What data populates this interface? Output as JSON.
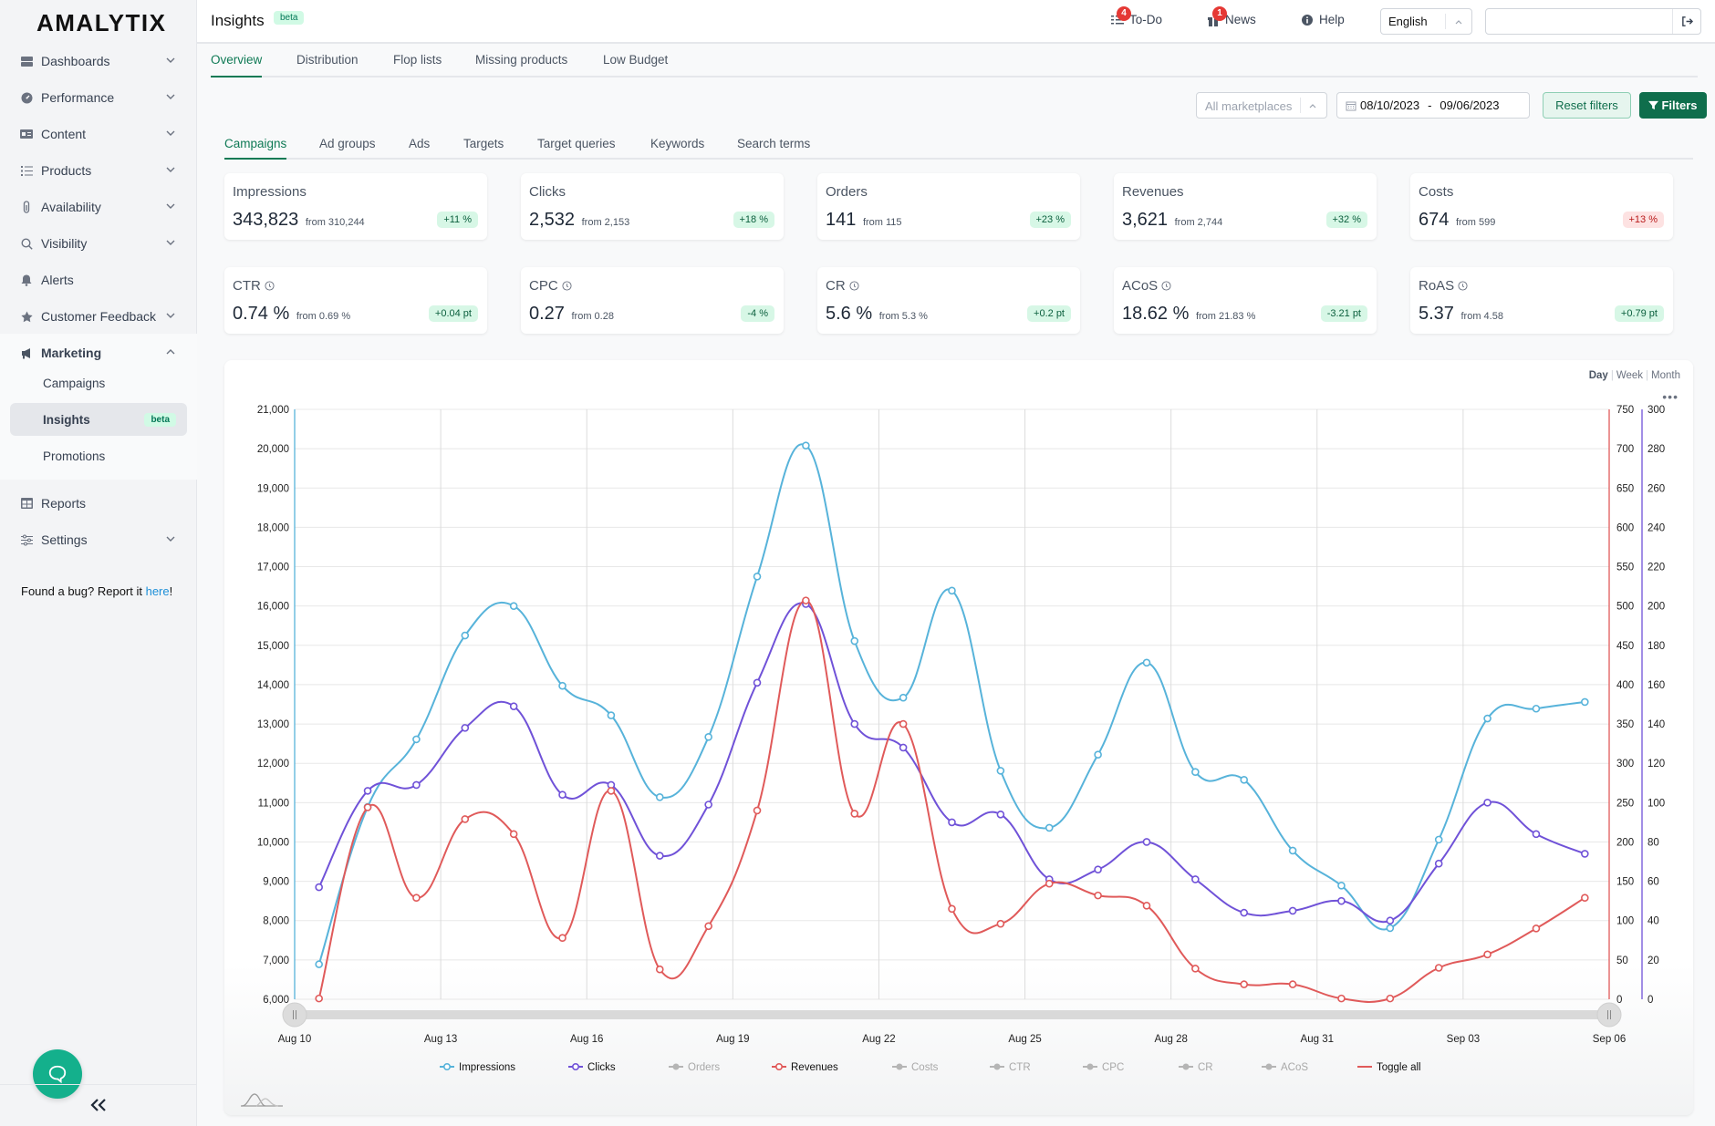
{
  "sidebar": {
    "logo": "AMALYTIX",
    "items": [
      {
        "label": "Dashboards",
        "icon": "server-icon",
        "chevron": "down"
      },
      {
        "label": "Performance",
        "icon": "gauge-icon",
        "chevron": "down"
      },
      {
        "label": "Content",
        "icon": "id-card-icon",
        "chevron": "down"
      },
      {
        "label": "Products",
        "icon": "list-icon",
        "chevron": "down"
      },
      {
        "label": "Availability",
        "icon": "thermometer-icon",
        "chevron": "down"
      },
      {
        "label": "Visibility",
        "icon": "search-icon",
        "chevron": "down"
      },
      {
        "label": "Alerts",
        "icon": "bell-icon",
        "chevron": ""
      },
      {
        "label": "Customer Feedback",
        "icon": "star-icon",
        "chevron": "down"
      },
      {
        "label": "Marketing",
        "icon": "megaphone-icon",
        "chevron": "up"
      },
      {
        "label": "Reports",
        "icon": "table-icon",
        "chevron": ""
      },
      {
        "label": "Settings",
        "icon": "sliders-icon",
        "chevron": "down"
      }
    ],
    "marketing_sub": [
      {
        "label": "Campaigns",
        "active": false
      },
      {
        "label": "Insights",
        "active": true,
        "badge": "beta"
      },
      {
        "label": "Promotions",
        "active": false
      }
    ],
    "bug_text": "Found a bug? Report it ",
    "bug_link": "here",
    "bug_suffix": "!"
  },
  "header": {
    "title": "Insights",
    "title_badge": "beta",
    "todo": {
      "label": "To-Do",
      "count": "4"
    },
    "news": {
      "label": "News",
      "count": "1"
    },
    "help": {
      "label": "Help"
    },
    "language": "English",
    "user_value": ""
  },
  "main_tabs": [
    {
      "label": "Overview",
      "active": true
    },
    {
      "label": "Distribution",
      "active": false
    },
    {
      "label": "Flop lists",
      "active": false
    },
    {
      "label": "Missing products",
      "active": false
    },
    {
      "label": "Low Budget",
      "active": false
    }
  ],
  "filters": {
    "marketplace_placeholder": "All marketplaces",
    "date_from": "08/10/2023",
    "date_sep": "-",
    "date_to": "09/06/2023",
    "reset_label": "Reset filters",
    "filters_label": "Filters"
  },
  "sub_tabs": [
    {
      "label": "Campaigns",
      "active": true
    },
    {
      "label": "Ad groups",
      "active": false
    },
    {
      "label": "Ads",
      "active": false
    },
    {
      "label": "Targets",
      "active": false
    },
    {
      "label": "Target queries",
      "active": false
    },
    {
      "label": "Keywords",
      "active": false
    },
    {
      "label": "Search terms",
      "active": false
    }
  ],
  "kpis": [
    {
      "label": "Impressions",
      "value": "343,823",
      "from": "from 310,244",
      "delta": "+11 %",
      "tone": "pos",
      "info": false
    },
    {
      "label": "Clicks",
      "value": "2,532",
      "from": "from 2,153",
      "delta": "+18 %",
      "tone": "pos",
      "info": false
    },
    {
      "label": "Orders",
      "value": "141",
      "from": "from 115",
      "delta": "+23 %",
      "tone": "pos",
      "info": false
    },
    {
      "label": "Revenues",
      "value": "3,621",
      "from": "from 2,744",
      "delta": "+32 %",
      "tone": "pos",
      "info": false
    },
    {
      "label": "Costs",
      "value": "674",
      "from": "from 599",
      "delta": "+13 %",
      "tone": "neg",
      "info": false
    },
    {
      "label": "CTR",
      "value": "0.74 %",
      "from": "from 0.69 %",
      "delta": "+0.04 pt",
      "tone": "pos",
      "info": true
    },
    {
      "label": "CPC",
      "value": "0.27",
      "from": "from 0.28",
      "delta": "-4 %",
      "tone": "pos",
      "info": true
    },
    {
      "label": "CR",
      "value": "5.6 %",
      "from": "from 5.3 %",
      "delta": "+0.2 pt",
      "tone": "pos",
      "info": true
    },
    {
      "label": "ACoS",
      "value": "18.62 %",
      "from": "from 21.83 %",
      "delta": "-3.21 pt",
      "tone": "pos",
      "info": true
    },
    {
      "label": "RoAS",
      "value": "5.37",
      "from": "from 4.58",
      "delta": "+0.79 pt",
      "tone": "pos",
      "info": true
    }
  ],
  "chart_controls": {
    "granularity": [
      "Day",
      "Week",
      "Month"
    ],
    "active_granularity": "Day",
    "menu": "•••"
  },
  "chart_data": {
    "type": "line",
    "title": "",
    "x": [
      "Aug 10",
      "Aug 11",
      "Aug 12",
      "Aug 13",
      "Aug 14",
      "Aug 15",
      "Aug 16",
      "Aug 17",
      "Aug 18",
      "Aug 19",
      "Aug 20",
      "Aug 21",
      "Aug 22",
      "Aug 23",
      "Aug 24",
      "Aug 25",
      "Aug 26",
      "Aug 27",
      "Aug 28",
      "Aug 29",
      "Aug 30",
      "Aug 31",
      "Sep 01",
      "Sep 02",
      "Sep 03",
      "Sep 04",
      "Sep 05"
    ],
    "x_tick_labels": [
      "Aug 10",
      "Aug 13",
      "Aug 16",
      "Aug 19",
      "Aug 22",
      "Aug 25",
      "Aug 28",
      "Aug 31",
      "Sep 03",
      "Sep 06"
    ],
    "x_range": [
      "Aug 10",
      "Sep 06"
    ],
    "axes": {
      "left": {
        "series": "Impressions",
        "range": [
          6000,
          21000
        ],
        "ticks": [
          "6,000",
          "7,000",
          "8,000",
          "9,000",
          "10,000",
          "11,000",
          "12,000",
          "13,000",
          "14,000",
          "15,000",
          "16,000",
          "17,000",
          "18,000",
          "19,000",
          "20,000",
          "21,000"
        ],
        "color": "#57b3da"
      },
      "right1": {
        "series": "Revenues",
        "range": [
          0,
          750
        ],
        "ticks": [
          "0",
          "50",
          "100",
          "150",
          "200",
          "250",
          "300",
          "350",
          "400",
          "450",
          "500",
          "550",
          "600",
          "650",
          "700",
          "750"
        ],
        "color": "#e05a5a"
      },
      "right2": {
        "series": "Clicks",
        "range": [
          0,
          300
        ],
        "ticks": [
          "0",
          "20",
          "40",
          "60",
          "80",
          "100",
          "120",
          "140",
          "160",
          "180",
          "200",
          "220",
          "240",
          "260",
          "280",
          "300"
        ],
        "color": "#7052d8"
      }
    },
    "series": [
      {
        "name": "Impressions",
        "axis": "left",
        "color": "#57b3da",
        "visible": true,
        "values": [
          6890,
          10890,
          12610,
          15250,
          16000,
          13970,
          13220,
          11140,
          12670,
          16750,
          20080,
          15110,
          13670,
          16390,
          11810,
          10360,
          12220,
          14560,
          11780,
          11580,
          9780,
          8890,
          7810,
          10060,
          13140,
          13390,
          13560
        ]
      },
      {
        "name": "Clicks",
        "axis": "right2",
        "color": "#7052d8",
        "visible": true,
        "values": [
          57,
          106,
          109,
          138,
          149,
          104,
          109,
          73,
          99,
          161,
          201,
          140,
          128,
          90,
          94,
          61,
          66,
          80,
          61,
          44,
          45,
          50,
          40,
          69,
          100,
          84,
          74
        ]
      },
      {
        "name": "Revenues",
        "axis": "right1",
        "color": "#e05a5a",
        "visible": true,
        "values": [
          1,
          244,
          129,
          229,
          210,
          78,
          265,
          38,
          93,
          240,
          507,
          236,
          350,
          115,
          96,
          147,
          132,
          119,
          39,
          19,
          19,
          1,
          1,
          40,
          57,
          90,
          129
        ]
      }
    ],
    "legend": [
      {
        "name": "Impressions",
        "visible": true,
        "color": "#57b3da"
      },
      {
        "name": "Clicks",
        "visible": true,
        "color": "#7052d8"
      },
      {
        "name": "Orders",
        "visible": false,
        "color": "#b5b5b5"
      },
      {
        "name": "Revenues",
        "visible": true,
        "color": "#e05a5a"
      },
      {
        "name": "Costs",
        "visible": false,
        "color": "#b5b5b5"
      },
      {
        "name": "CTR",
        "visible": false,
        "color": "#b5b5b5"
      },
      {
        "name": "CPC",
        "visible": false,
        "color": "#b5b5b5"
      },
      {
        "name": "CR",
        "visible": false,
        "color": "#b5b5b5"
      },
      {
        "name": "ACoS",
        "visible": false,
        "color": "#b5b5b5"
      },
      {
        "name": "Toggle all",
        "visible": true,
        "color": "#e05a5a",
        "toggle": true
      }
    ],
    "legend_position": "bottom",
    "grid": true
  }
}
